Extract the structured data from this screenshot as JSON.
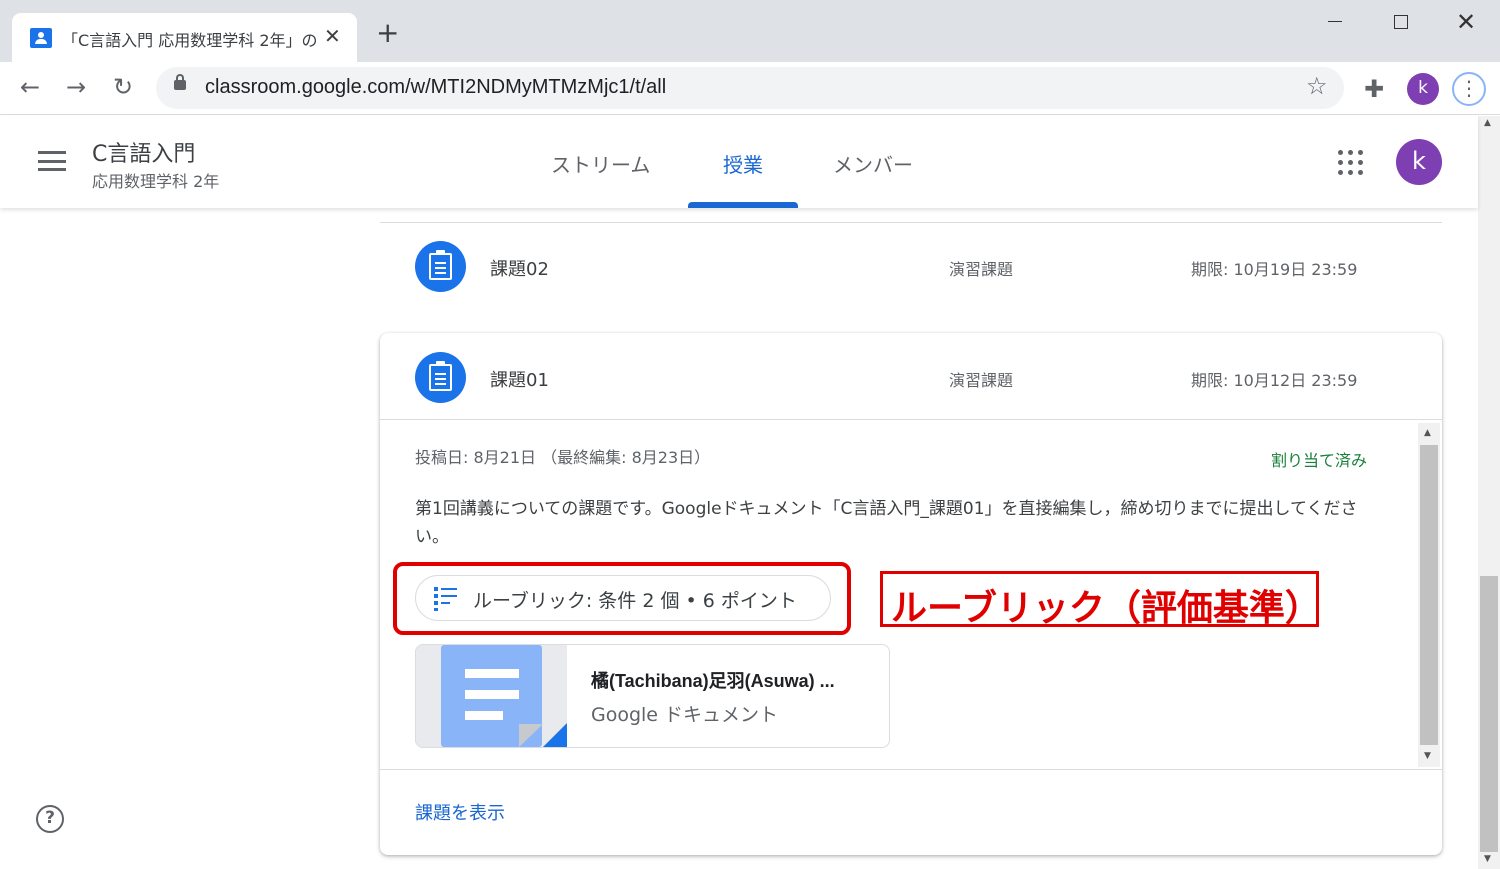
{
  "browser": {
    "tab_title": "「C言語入門 応用数理学科 2年」の",
    "close_glyph": "✕",
    "newtab_glyph": "+",
    "window_close_glyph": "✕",
    "url": "classroom.google.com/w/MTI2NDMyMTMzMjc1/t/all",
    "profile_initial": "k",
    "back_glyph": "←",
    "forward_glyph": "→",
    "reload_glyph": "↻",
    "star_glyph": "☆",
    "ext_glyph": "✚",
    "menu_glyph": "⋮"
  },
  "header": {
    "class_name": "C言語入門",
    "class_section": "応用数理学科 2年",
    "tabs": [
      {
        "label": "ストリーム"
      },
      {
        "label": "授業"
      },
      {
        "label": "メンバー"
      }
    ],
    "profile_initial": "k"
  },
  "assignments": [
    {
      "title": "課題02",
      "topic": "演習課題",
      "due": "期限: 10月19日 23:59"
    },
    {
      "title": "課題01",
      "topic": "演習課題",
      "due": "期限: 10月12日 23:59"
    }
  ],
  "detail": {
    "posted": "投稿日: 8月21日 （最終編集: 8月23日）",
    "status": "割り当て済み",
    "description": "第1回講義についての課題です。Googleドキュメント「C言語入門_課題01」を直接編集し，締め切りまでに提出してください。",
    "rubric": "ルーブリック: 条件 2 個 • 6 ポイント",
    "attachment_title": "橘(Tachibana)足羽(Asuwa) ...",
    "attachment_type": "Google ドキュメント",
    "view_link": "課題を表示"
  },
  "annotation": {
    "label": "ルーブリック（評価基準）"
  },
  "help_glyph": "?",
  "colors": {
    "accent": "#1967d2",
    "avatar": "#7e3fb2",
    "assigned_green": "#188038",
    "annotation_red": "#e00000"
  }
}
